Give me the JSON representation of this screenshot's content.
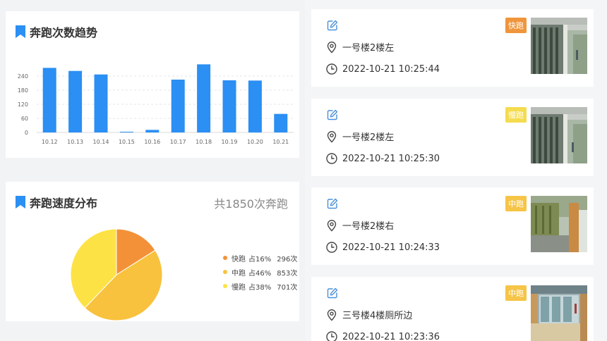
{
  "trend": {
    "title": "奔跑次数趋势",
    "chart_data": {
      "type": "bar",
      "categories": [
        "10.12",
        "10.13",
        "10.14",
        "10.15",
        "10.16",
        "10.17",
        "10.18",
        "10.19",
        "10.20",
        "10.21"
      ],
      "values": [
        275,
        262,
        247,
        3,
        11,
        225,
        290,
        222,
        221,
        79
      ],
      "yticks": [
        0,
        60,
        120,
        180,
        240
      ],
      "ylim": [
        0,
        300
      ],
      "color": "#2b8ff3",
      "grid": "dashed horizontal"
    }
  },
  "speed": {
    "title": "奔跑速度分布",
    "total_text": "共1850次奔跑",
    "chart_data": {
      "type": "pie",
      "slices": [
        {
          "name": "快跑",
          "pct_label": "占16%",
          "count_label": "296次",
          "value": 296,
          "color": "#f39138"
        },
        {
          "name": "中跑",
          "pct_label": "占46%",
          "count_label": "853次",
          "value": 853,
          "color": "#f8c23e"
        },
        {
          "name": "慢跑",
          "pct_label": "占38%",
          "count_label": "701次",
          "value": 701,
          "color": "#fde245"
        }
      ]
    }
  },
  "records": [
    {
      "location": "一号楼2楼左",
      "time": "2022-10-21 10:25:44",
      "badge": "快跑",
      "badge_color": "#f0953b"
    },
    {
      "location": "一号楼2楼左",
      "time": "2022-10-21 10:25:30",
      "badge": "慢跑",
      "badge_color": "#f5dc4f"
    },
    {
      "location": "一号楼2楼右",
      "time": "2022-10-21 10:24:33",
      "badge": "中跑",
      "badge_color": "#f6c446"
    },
    {
      "location": "三号楼4楼厕所边",
      "time": "2022-10-21 10:23:36",
      "badge": "中跑",
      "badge_color": "#f6c446"
    }
  ],
  "icons": {
    "edit": "edit-icon",
    "location": "location-pin-icon",
    "time": "clock-icon",
    "bookmark": "bookmark-icon"
  },
  "colors": {
    "accent": "#2b8ff3",
    "edit_icon": "#4a90d9"
  }
}
